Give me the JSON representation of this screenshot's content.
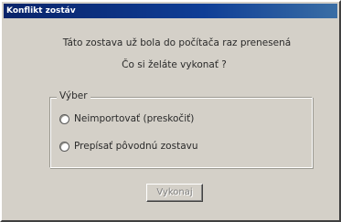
{
  "window": {
    "title": "Konflikt zostáv"
  },
  "message": {
    "line1": "Táto zostava už bola do počítača raz prenesená",
    "line2": "Čo si želáte vykonať ?"
  },
  "group": {
    "label": "Výber",
    "options": [
      {
        "label": "Neimportovať (preskočiť)",
        "selected": false
      },
      {
        "label": "Prepísať pôvodnú zostavu",
        "selected": false
      }
    ]
  },
  "action": {
    "button_label": "Vykonaj",
    "enabled": false
  },
  "colors": {
    "title_bar": "#0a246a",
    "dialog_face": "#d4d0c8"
  }
}
